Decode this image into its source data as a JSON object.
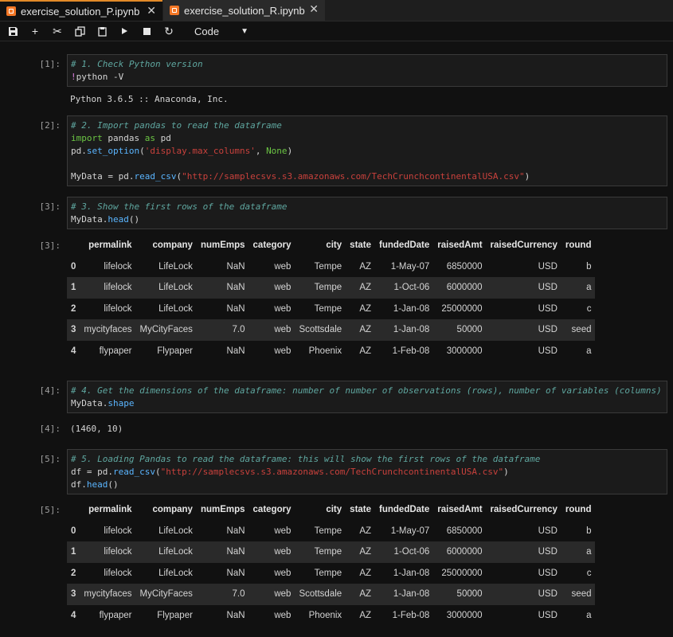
{
  "tabs": [
    {
      "label": "exercise_solution_P.ipynb",
      "active": true
    },
    {
      "label": "exercise_solution_R.ipynb",
      "active": false
    }
  ],
  "toolbar": {
    "cell_type": "Code"
  },
  "cells": {
    "c1": {
      "prompt": "[1]:",
      "comment": "# 1. Check Python version",
      "code_bang": "!",
      "code_rest": "python -V"
    },
    "o1": {
      "text": "Python 3.6.5 :: Anaconda, Inc."
    },
    "c2": {
      "prompt": "[2]:",
      "comment": "# 2. Import pandas to read the dataframe",
      "kw_import": "import",
      "mod_pandas": " pandas ",
      "kw_as": "as",
      "alias": " pd",
      "l3_pd": "pd.",
      "l3_fn": "set_option",
      "l3_open": "(",
      "l3_str": "'display.max_columns'",
      "l3_mid": ", ",
      "l3_none": "None",
      "l3_close": ")",
      "l5_var": "MyData = pd.",
      "l5_fn": "read_csv",
      "l5_open": "(",
      "l5_str": "\"http://samplecsvs.s3.amazonaws.com/TechCrunchcontinentalUSA.csv\"",
      "l5_close": ")"
    },
    "c3": {
      "prompt": "[3]:",
      "comment": "# 3. Show the first rows of the dataframe",
      "var": "MyData.",
      "fn": "head",
      "tail": "()"
    },
    "o3": {
      "prompt": "[3]:"
    },
    "c4": {
      "prompt": "[4]:",
      "comment": "# 4. Get the dimensions of the dataframe: number of number of observations (rows), number of variables (columns)",
      "var": "MyData.",
      "fn": "shape"
    },
    "o4": {
      "prompt": "[4]:",
      "text": "(1460, 10)"
    },
    "c5": {
      "prompt": "[5]:",
      "comment": "# 5. Loading Pandas to read the dataframe: this will show the first rows of the dataframe",
      "l2_var": "df = pd.",
      "l2_fn": "read_csv",
      "l2_open": "(",
      "l2_str": "\"http://samplecsvs.s3.amazonaws.com/TechCrunchcontinentalUSA.csv\"",
      "l2_close": ")",
      "l3_var": "df.",
      "l3_fn": "head",
      "l3_tail": "()"
    },
    "o5": {
      "prompt": "[5]:"
    }
  },
  "dataframe": {
    "columns": [
      "",
      "permalink",
      "company",
      "numEmps",
      "category",
      "city",
      "state",
      "fundedDate",
      "raisedAmt",
      "raisedCurrency",
      "round"
    ],
    "rows": [
      [
        "0",
        "lifelock",
        "LifeLock",
        "NaN",
        "web",
        "Tempe",
        "AZ",
        "1-May-07",
        "6850000",
        "USD",
        "b"
      ],
      [
        "1",
        "lifelock",
        "LifeLock",
        "NaN",
        "web",
        "Tempe",
        "AZ",
        "1-Oct-06",
        "6000000",
        "USD",
        "a"
      ],
      [
        "2",
        "lifelock",
        "LifeLock",
        "NaN",
        "web",
        "Tempe",
        "AZ",
        "1-Jan-08",
        "25000000",
        "USD",
        "c"
      ],
      [
        "3",
        "mycityfaces",
        "MyCityFaces",
        "7.0",
        "web",
        "Scottsdale",
        "AZ",
        "1-Jan-08",
        "50000",
        "USD",
        "seed"
      ],
      [
        "4",
        "flypaper",
        "Flypaper",
        "NaN",
        "web",
        "Phoenix",
        "AZ",
        "1-Feb-08",
        "3000000",
        "USD",
        "a"
      ]
    ]
  }
}
